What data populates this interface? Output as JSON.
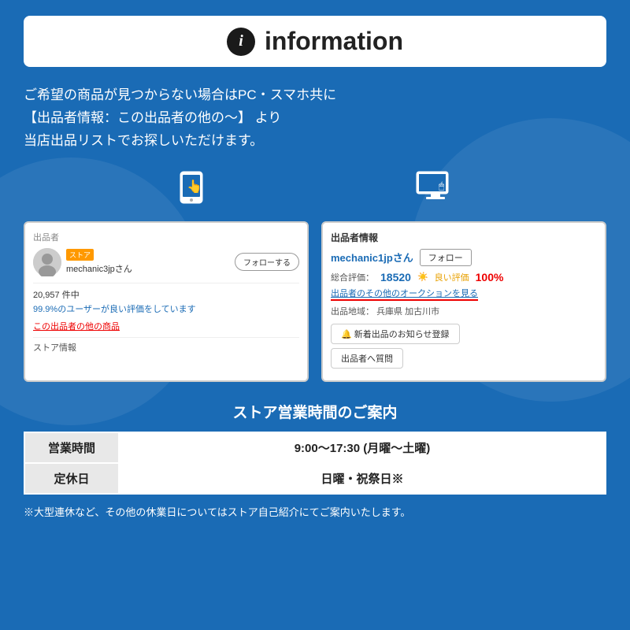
{
  "header": {
    "icon_text": "i",
    "title": "information"
  },
  "description": {
    "line1": "ご希望の商品が見つからない場合はPC・スマホ共に",
    "line2": "【出品者情報：この出品者の他の〜】 より",
    "line3": "当店出品リストでお探しいただけます。"
  },
  "mobile_screenshot": {
    "section_label": "出品者",
    "store_badge": "ストア",
    "seller_name": "mechanic3jpさん",
    "follow_label": "フォローする",
    "review_count": "20,957 件中",
    "review_pct": "99.9%のユーザーが良い評価をしています",
    "other_items_link": "この出品者の他の商品",
    "store_info_label": "ストア情報"
  },
  "pc_screenshot": {
    "section_label": "出品者情報",
    "seller_name": "mechanic1jpさん",
    "follow_label": "フォロー",
    "rating_label": "総合評価：",
    "rating_value": "18520",
    "good_label": "良い評価",
    "good_pct": "100%",
    "auction_link": "出品者のその他のオークションを見る",
    "location_label": "出品地域：",
    "location_value": "兵庫県 加古川市",
    "notify_btn": "🔔 新着出品のお知らせ登録",
    "question_btn": "出品者へ質問"
  },
  "store_hours": {
    "title": "ストア営業時間のご案内",
    "rows": [
      {
        "label": "営業時間",
        "value": "9:00〜17:30 (月曜〜土曜)"
      },
      {
        "label": "定休日",
        "value": "日曜・祝祭日※"
      }
    ],
    "note": "※大型連休など、その他の休業日についてはストア自己紹介にてご案内いたします。"
  }
}
